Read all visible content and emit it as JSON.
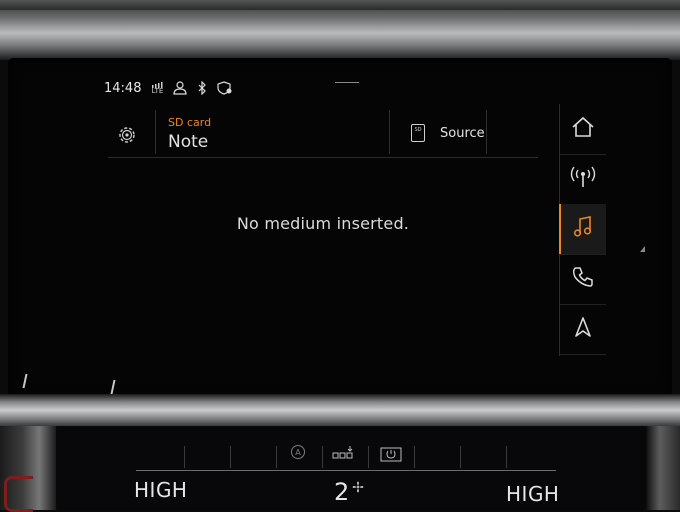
{
  "status_bar": {
    "time": "14:48",
    "network": "LTE",
    "icons": [
      "lte-signal-icon",
      "user-profile-icon",
      "bluetooth-icon",
      "location-shield-icon"
    ]
  },
  "media_header": {
    "source_caption": "SD card",
    "source_title": "Note",
    "source_button_label": "Source",
    "source_button_icon_text": "SD"
  },
  "main": {
    "message": "No medium inserted."
  },
  "side_rail": {
    "items": [
      {
        "icon": "home-icon",
        "active": false
      },
      {
        "icon": "radio-antenna-icon",
        "active": false
      },
      {
        "icon": "music-note-icon",
        "active": true
      },
      {
        "icon": "phone-icon",
        "active": false
      },
      {
        "icon": "navigation-arrow-icon",
        "active": false
      }
    ]
  },
  "climate": {
    "left_fan": "HIGH",
    "fan_level": "2",
    "right_fan": "HIGH"
  },
  "colors": {
    "accent": "#e8872a",
    "text": "#dcdcdc",
    "background": "#050505"
  }
}
